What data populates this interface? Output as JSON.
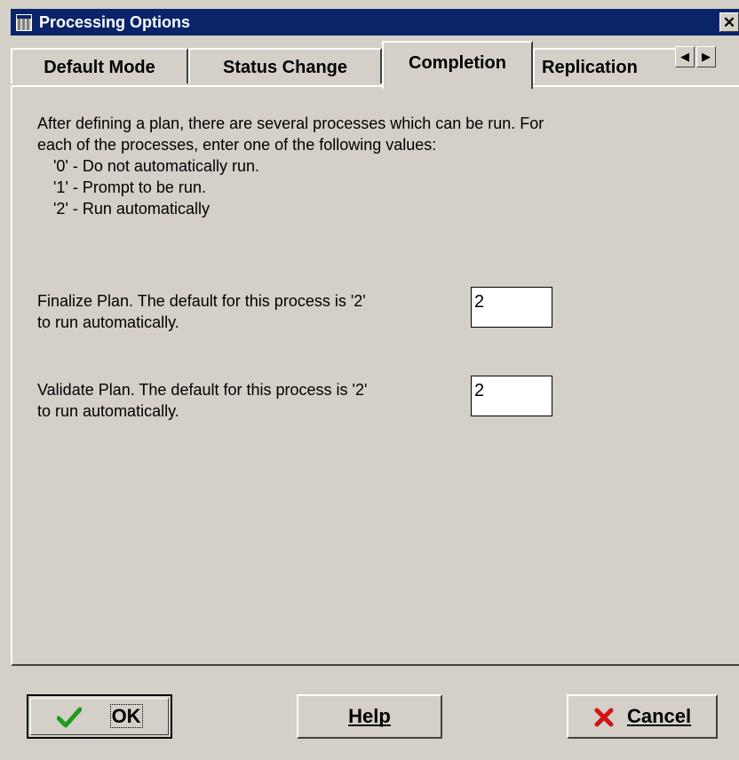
{
  "window": {
    "title": "Processing Options",
    "close_label": "✕"
  },
  "tabs": [
    {
      "label": "Default Mode"
    },
    {
      "label": "Status Change"
    },
    {
      "label": "Completion",
      "active": true
    },
    {
      "label": "Replication"
    }
  ],
  "tab_scroll": {
    "left": "◀",
    "right": "▶"
  },
  "content": {
    "intro": [
      "After defining a plan, there are several processes which can be run.  For",
      "each of the processes, enter one of the following values:",
      "'0' - Do not automatically run.",
      "'1' - Prompt to be run.",
      "'2' - Run automatically"
    ],
    "options": [
      {
        "line1": "Finalize Plan. The default for this process is '2'",
        "line2": "to run automatically.",
        "value": "2"
      },
      {
        "line1": "Validate Plan. The default for this process is '2'",
        "line2": "to run automatically.",
        "value": "2"
      }
    ]
  },
  "buttons": {
    "ok": {
      "label": "OK",
      "icon": "checkmark-icon",
      "icon_color": "#1e9a1e"
    },
    "help": {
      "label": "Help"
    },
    "cancel": {
      "label": "Cancel",
      "icon": "x-icon",
      "icon_color": "#d21414"
    }
  }
}
